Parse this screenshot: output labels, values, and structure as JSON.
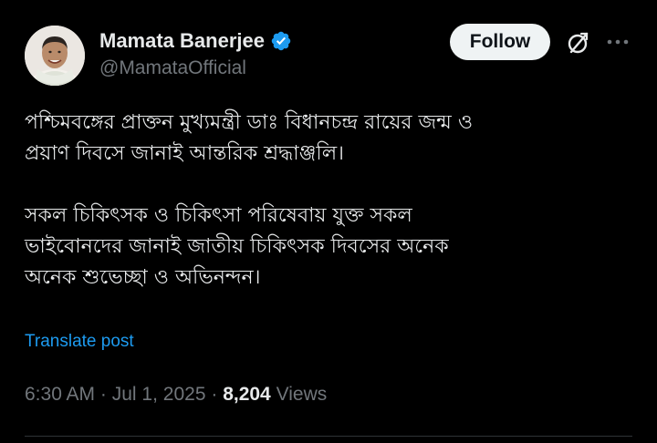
{
  "author": {
    "display_name": "Mamata Banerjee",
    "handle": "@MamataOfficial",
    "verified": true
  },
  "actions": {
    "follow_label": "Follow",
    "grok_icon": "grok-icon",
    "more_icon": "more-horizontal-icon"
  },
  "post": {
    "paragraphs": [
      "পশ্চিমবঙ্গের প্রাক্তন মুখ্যমন্ত্রী ডাঃ বিধানচন্দ্র রায়ের জন্ম ও\nপ্রয়াণ দিবসে জানাই আন্তরিক শ্রদ্ধাঞ্জলি।",
      "সকল চিকিৎসক ও চিকিৎসা পরিষেবায় যুক্ত সকল\nভাইবোনদের  জানাই জাতীয় চিকিৎসক দিবসের অনেক\nঅনেক শুভেচ্ছা ও অভিনন্দন।"
    ],
    "translate_label": "Translate post"
  },
  "meta": {
    "time": "6:30 AM",
    "date": "Jul 1, 2025",
    "views_count": "8,204",
    "views_label": "Views",
    "separator": "·"
  },
  "colors": {
    "background": "#000000",
    "text_primary": "#e7e9ea",
    "text_secondary": "#71767b",
    "accent_link": "#1d9bf0",
    "verified_badge": "#1d9bf0",
    "follow_bg": "#eff3f4",
    "divider": "#2f3336"
  }
}
